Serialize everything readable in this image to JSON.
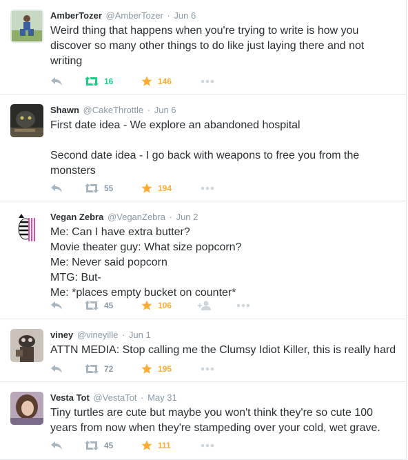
{
  "tweets": [
    {
      "fullname": "AmberTozer",
      "username": "@AmberTozer",
      "sep": "·",
      "time": "Jun 6",
      "text": "Weird thing that happens when you're trying to write is how you discover so many other things to do like just laying there and not writing",
      "retweets": "16",
      "favorites": "146",
      "retweeted": true
    },
    {
      "fullname": "Shawn",
      "username": "@CakeThrottle",
      "sep": "·",
      "time": "Jun 6",
      "text": "First date idea - We explore an abandoned hospital\n\nSecond date idea - I go back with weapons to free you from the monsters",
      "retweets": "55",
      "favorites": "194",
      "retweeted": false
    },
    {
      "fullname": "Vegan Zebra",
      "username": "@VeganZebra",
      "sep": "·",
      "time": "Jun 2",
      "text": "Me: Can I have extra butter?\nMovie theater guy: What size popcorn?\nMe: Never said popcorn\nMTG: But-\nMe: *places empty bucket on counter*",
      "retweets": "45",
      "favorites": "106",
      "retweeted": false
    },
    {
      "fullname": "viney",
      "username": "@vineyille",
      "sep": "·",
      "time": "Jun 1",
      "text": "ATTN MEDIA: Stop calling me the Clumsy Idiot Killer, this is really hard",
      "retweets": "72",
      "favorites": "195",
      "retweeted": false
    },
    {
      "fullname": "Vesta Tot",
      "username": "@VestaTot",
      "sep": "·",
      "time": "May 31",
      "text": "Tiny turtles are cute but maybe you won't think they're so cute 100 years from now when they're stampeding over your cold, wet grave.",
      "retweets": "45",
      "favorites": "111",
      "retweeted": false
    }
  ],
  "colors": {
    "retweet_active": "#19cf86",
    "favorite": "#ffac33",
    "muted": "#8899a6",
    "text": "#292f33",
    "border": "#e1e8ed"
  }
}
